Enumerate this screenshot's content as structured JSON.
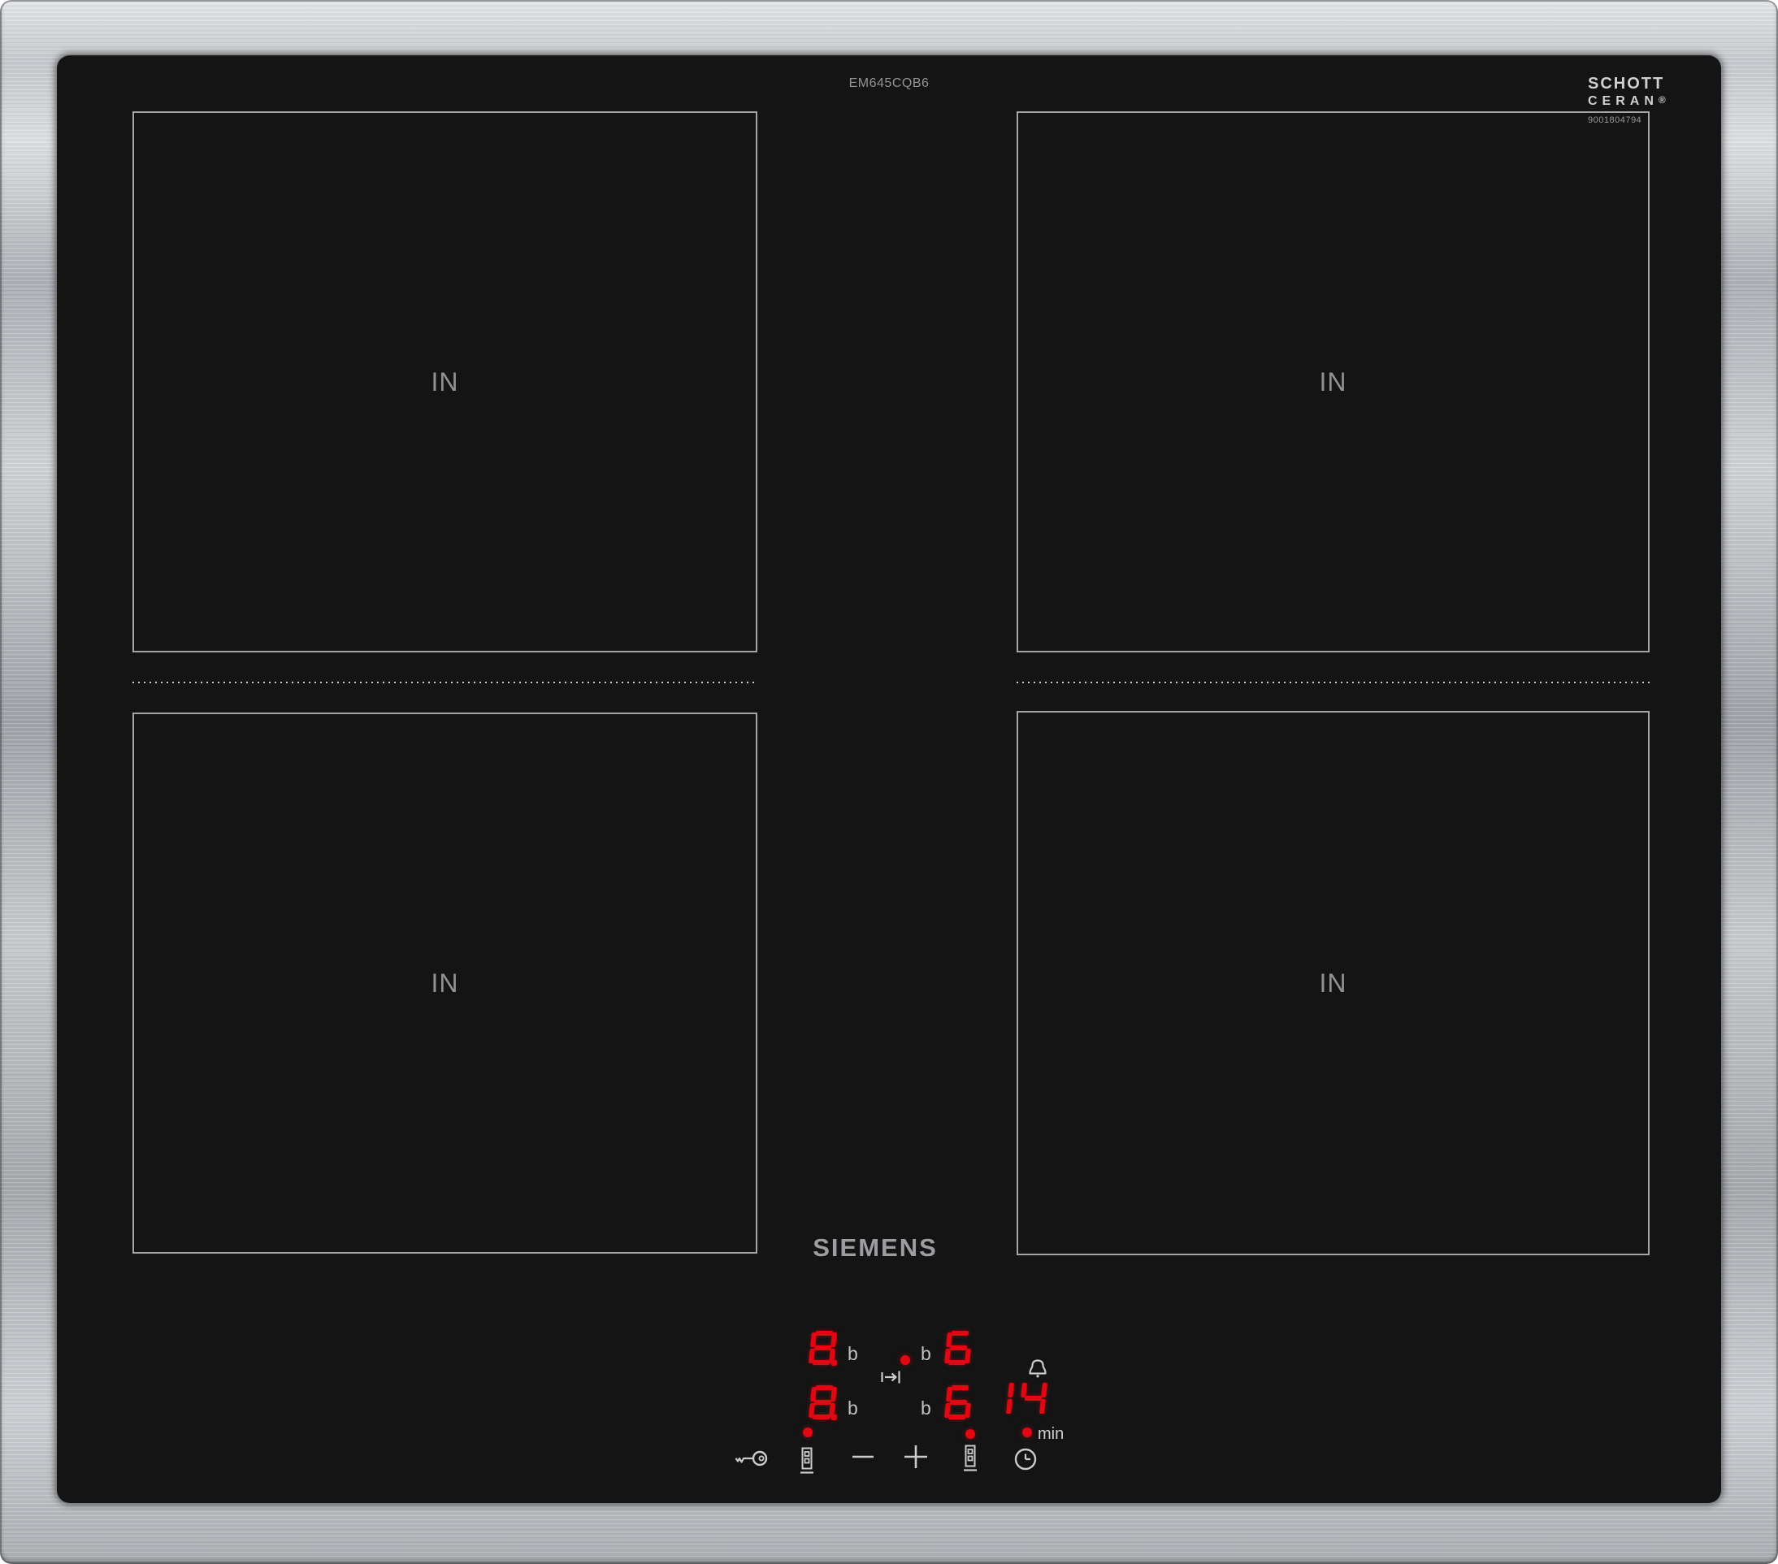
{
  "product": {
    "brand": "SIEMENS",
    "model": "EM645CQB6",
    "glass_brand_line1": "SCHOTT",
    "glass_brand_line2": "CERAN",
    "glass_brand_reg": "®",
    "serial": "9001804794"
  },
  "zones": [
    {
      "id": "rear-left",
      "indicator": "IN"
    },
    {
      "id": "rear-right",
      "indicator": "IN"
    },
    {
      "id": "front-left",
      "indicator": "IN"
    },
    {
      "id": "front-right",
      "indicator": "IN"
    }
  ],
  "display": {
    "left_top": {
      "value": "8",
      "decimal": true,
      "unit": "b"
    },
    "left_bottom": {
      "value": "8",
      "decimal": true,
      "unit": "b"
    },
    "right_top": {
      "unit": "b",
      "value": "6",
      "decimal": false
    },
    "right_bottom": {
      "unit": "b",
      "value": "6",
      "decimal": false
    },
    "timer": {
      "digits": [
        "1",
        "4"
      ],
      "unit": "min"
    }
  },
  "controls": {
    "icons": [
      "child-lock-key",
      "power-slider-left",
      "minus",
      "plus",
      "power-slider-right",
      "timer-clock"
    ],
    "indicators": [
      "timer-transfer-arrow",
      "alarm-bell",
      "zone-select-dot-center",
      "slider-active-dot-left",
      "slider-active-dot-right",
      "timer-min-dot"
    ]
  },
  "colors": {
    "display_red": "#e30613",
    "icon_gray": "#c9cbcd",
    "label_gray": "#9a9c9e",
    "zone_border": "#a3a5a7",
    "glass_black": "#141414",
    "steel_silver": "#b7babe"
  }
}
